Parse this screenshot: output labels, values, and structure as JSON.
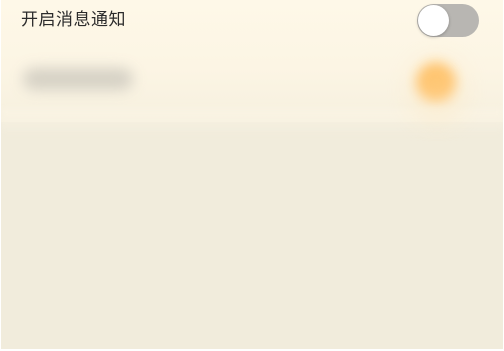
{
  "settings": {
    "notification_toggle": {
      "label": "开启消息通知",
      "state": "off"
    }
  },
  "colors": {
    "header_background": "#fcf5e4",
    "page_background": "#f1ecdc",
    "toggle_off": "#b8b6b2",
    "blurred_accent": "#ffb347"
  }
}
